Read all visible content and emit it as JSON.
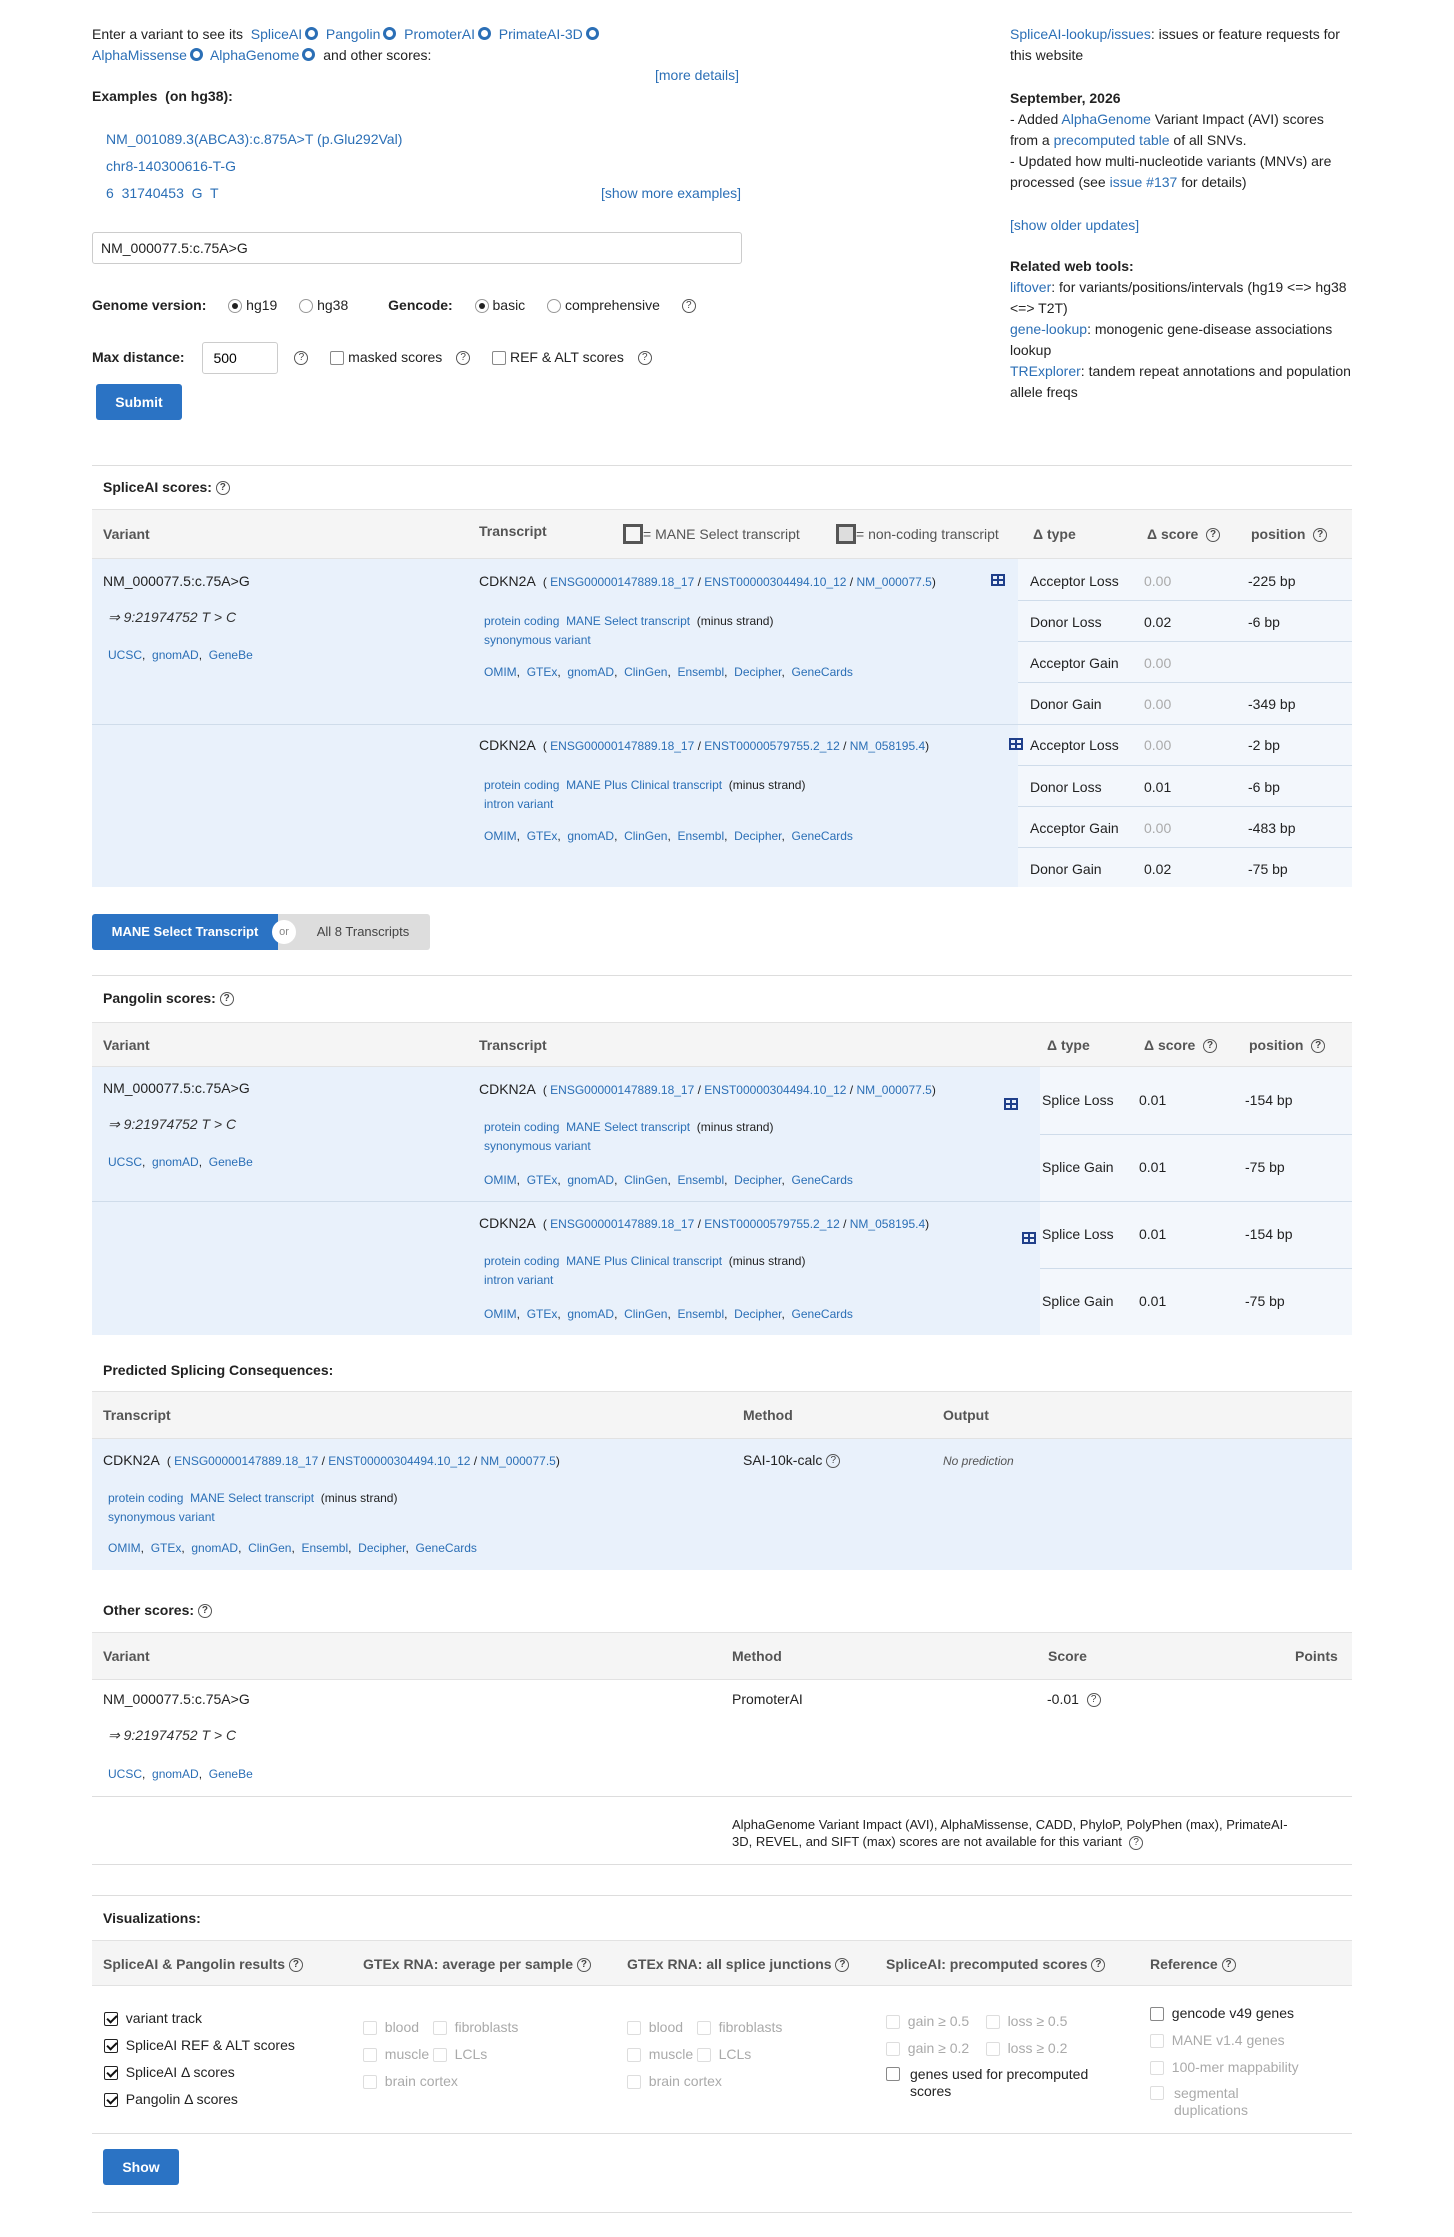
{
  "intro": {
    "prefix": "Enter a variant to see its",
    "tools": [
      "SpliceAI",
      "Pangolin",
      "PromoterAI",
      "PrimateAI-3D",
      "AlphaMissense",
      "AlphaGenome"
    ],
    "suffix": "and other scores:",
    "more_details": "[more details]"
  },
  "examples": {
    "title": "Examples",
    "build": "(on hg38):",
    "items": [
      "NM_001089.3(ABCA3):c.875A>T (p.Glu292Val)",
      "chr8-140300616-T-G",
      "6  31740453  G  T"
    ],
    "show_more": "[show more examples]"
  },
  "search": {
    "value": "NM_000077.5:c.75A>G"
  },
  "options": {
    "genome_label": "Genome version:",
    "genome_opts": [
      "hg19",
      "hg38"
    ],
    "gencode_label": "Gencode:",
    "gencode_opts": [
      "basic",
      "comprehensive"
    ],
    "maxdist_label": "Max distance:",
    "maxdist_value": "500",
    "masked": "masked scores",
    "refalt": "REF & ALT scores",
    "submit": "Submit"
  },
  "side": {
    "issues_link": "SpliceAI-lookup/issues",
    "issues_text": ": issues or feature requests for this website",
    "date": "September, 2026",
    "u1a": "- Added ",
    "u1b": "AlphaGenome",
    "u1c": " Variant Impact (AVI) scores from a ",
    "u1d": "precomputed table",
    "u1e": " of all SNVs.",
    "u2a": "- Updated how multi-nucleotide variants (MNVs) are processed (see ",
    "u2b": "issue #137",
    "u2c": " for details)",
    "older": "[show older updates]",
    "related": "Related web tools:",
    "t1": "liftover",
    "t1d": ": for variants/positions/intervals (hg19 <=> hg38 <=> T2T)",
    "t2": "gene-lookup",
    "t2d": ": monogenic gene-disease associations lookup",
    "t3": "TRExplorer",
    "t3d": ": tandem repeat annotations and population allele freqs"
  },
  "variant": {
    "id": "NM_000077.5:c.75A>G",
    "hg": "⇒ 9:21974752 T > C",
    "links": [
      "UCSC",
      "gnomAD",
      "GeneBe"
    ]
  },
  "tx": {
    "gene": "CDKN2A",
    "ensg": "ENSG00000147889.18_17",
    "t1_enst": "ENST00000304494.10_12",
    "t1_nm": "NM_000077.5",
    "t1_type": "MANE Select transcript",
    "t1_cons": "synonymous variant",
    "t2_enst": "ENST00000579755.2_12",
    "t2_nm": "NM_058195.4",
    "t2_type": "MANE Plus Clinical transcript",
    "t2_cons": "intron variant",
    "coding": "protein coding",
    "strand": "(minus strand)",
    "dblinks": [
      "OMIM",
      "GTEx",
      "gnomAD",
      "ClinGen",
      "Ensembl",
      "Decipher",
      "GeneCards"
    ]
  },
  "spliceai": {
    "title": "SpliceAI scores:",
    "h_variant": "Variant",
    "h_transcript": "Transcript",
    "mane_legend": "= MANE Select transcript",
    "noncoding_legend": "= non-coding transcript",
    "h_type": "Δ type",
    "h_score": "Δ score",
    "h_pos": "position",
    "rows": [
      [
        "Acceptor Loss",
        "0.00",
        "-225 bp"
      ],
      [
        "Donor Loss",
        "0.02",
        "-6 bp"
      ],
      [
        "Acceptor Gain",
        "0.00",
        ""
      ],
      [
        "Donor Gain",
        "0.00",
        "-349 bp"
      ],
      [
        "Acceptor Loss",
        "0.00",
        "-2 bp"
      ],
      [
        "Donor Loss",
        "0.01",
        "-6 bp"
      ],
      [
        "Acceptor Gain",
        "0.00",
        "-483 bp"
      ],
      [
        "Donor Gain",
        "0.02",
        "-75 bp"
      ]
    ]
  },
  "toggle": {
    "mane": "MANE Select Transcript",
    "or": "or",
    "all": "All 8 Transcripts"
  },
  "pangolin": {
    "title": "Pangolin scores:",
    "rows": [
      [
        "Splice Loss",
        "0.01",
        "-154 bp"
      ],
      [
        "Splice Gain",
        "0.01",
        "-75 bp"
      ],
      [
        "Splice Loss",
        "0.01",
        "-154 bp"
      ],
      [
        "Splice Gain",
        "0.01",
        "-75 bp"
      ]
    ]
  },
  "consequences": {
    "title": "Predicted Splicing Consequences:",
    "h_transcript": "Transcript",
    "h_method": "Method",
    "h_output": "Output",
    "method": "SAI-10k-calc",
    "output": "No prediction"
  },
  "other": {
    "title": "Other scores:",
    "h_variant": "Variant",
    "h_method": "Method",
    "h_score": "Score",
    "h_points": "Points",
    "method": "PromoterAI",
    "score": "-0.01",
    "na": "AlphaGenome Variant Impact (AVI),  AlphaMissense,  CADD,  PhyloP,  PolyPhen (max),  PrimateAI-3D,  REVEL,  and SIFT (max) scores are not available for this variant"
  },
  "viz": {
    "title": "Visualizations:",
    "h1": "SpliceAI & Pangolin results",
    "h2": "GTEx RNA: average per sample",
    "h3": "GTEx RNA: all splice junctions",
    "h4": "SpliceAI: precomputed scores",
    "h5": "Reference",
    "c1": [
      "variant track",
      "SpliceAI REF & ALT scores",
      "SpliceAI Δ  scores",
      "Pangolin Δ  scores"
    ],
    "tissues": [
      "blood",
      "fibroblasts",
      "muscle",
      "LCLs",
      "brain cortex"
    ],
    "pre": [
      "gain ≥ 0.5",
      "loss ≥ 0.5",
      "gain ≥ 0.2",
      "loss ≥ 0.2",
      "genes used for precomputed scores"
    ],
    "ref": [
      "gencode v49 genes",
      "MANE v1.4 genes",
      "100-mer mappability",
      "segmental duplications"
    ],
    "show": "Show"
  }
}
